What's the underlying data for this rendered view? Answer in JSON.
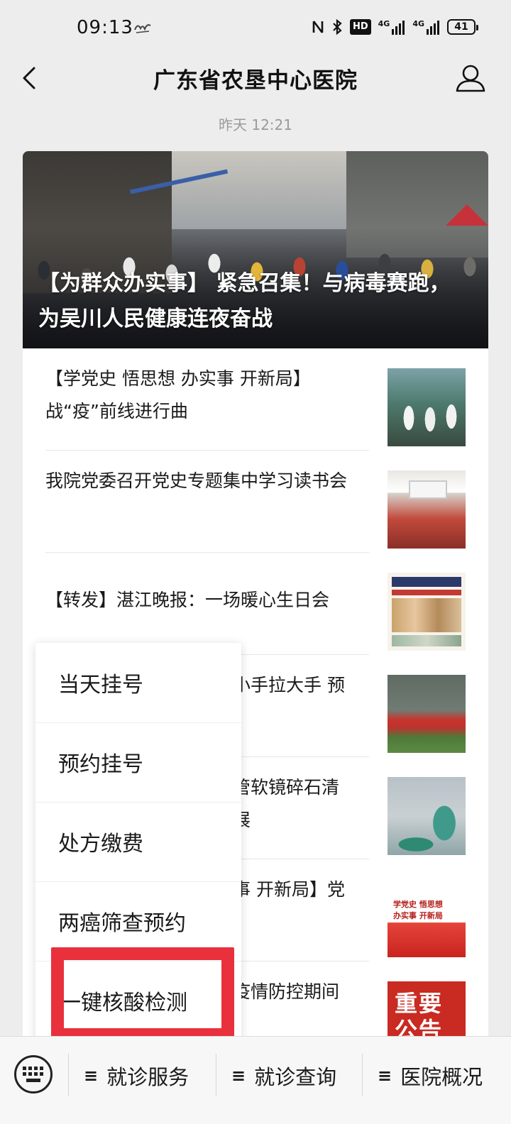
{
  "status_bar": {
    "time": "09:13",
    "network_1": "4G",
    "network_2": "4G",
    "hd_label": "HD",
    "battery": "41"
  },
  "header": {
    "title": "广东省农垦中心医院"
  },
  "timestamp": "昨天 12:21",
  "hero": {
    "title": "【为群众办实事】 紧急召集！与病毒赛跑，为吴川人民健康连夜奋战"
  },
  "news": [
    {
      "title": "【学党史 悟思想 办实事 开新局】 战“疫”前线进行曲",
      "thumb": "thumb-1"
    },
    {
      "title": "我院党委召开党史专题集中学习读书会",
      "thumb": "thumb-2"
    },
    {
      "title": "【转发】湛江晚报：一场暖心生日会",
      "thumb": "thumb-3"
    },
    {
      "title": "小手拉大手 预",
      "thumb": "thumb-4"
    },
    {
      "title": "管软镜碎石清\n展",
      "thumb": "thumb-5"
    },
    {
      "title": "事 开新局】党",
      "thumb": "thumb-6",
      "thumb_text": "学党史 悟思想\n办实事 开新局"
    },
    {
      "title": "疫情防控期间",
      "thumb": "thumb-7",
      "thumb_text": "重要\n公告"
    }
  ],
  "popup_menu": {
    "items": [
      {
        "label": "当天挂号"
      },
      {
        "label": "预约挂号"
      },
      {
        "label": "处方缴费"
      },
      {
        "label": "两癌筛查预约"
      },
      {
        "label": "一键核酸检测"
      }
    ]
  },
  "bottom_bar": {
    "tabs": [
      {
        "label": "就诊服务"
      },
      {
        "label": "就诊查询"
      },
      {
        "label": "医院概况"
      }
    ],
    "menu_glyph": "≡"
  },
  "colors": {
    "highlight": "#e8313c",
    "background": "#ededed"
  },
  "icons": {
    "back": "back-arrow-icon",
    "profile": "user-profile-icon",
    "keyboard": "keyboard-icon"
  }
}
